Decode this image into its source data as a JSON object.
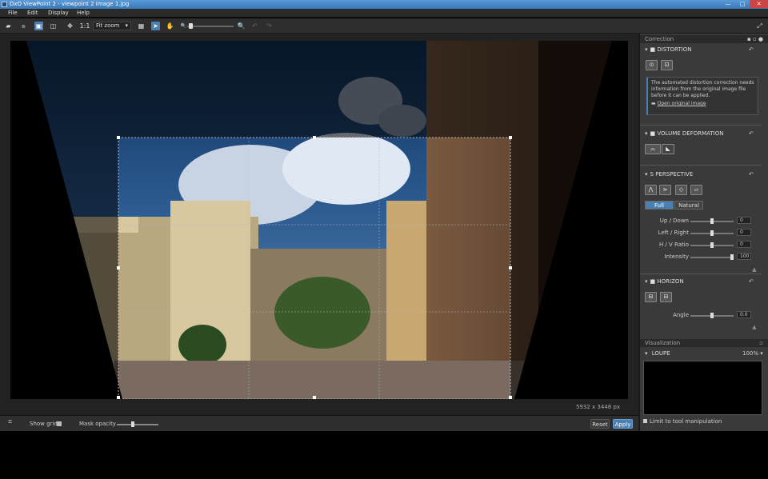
{
  "window": {
    "title": "DxO ViewPoint 2 - viewpoint 2 image 1.jpg",
    "min": "—",
    "max": "□",
    "close": "✕"
  },
  "menu": [
    "File",
    "Edit",
    "Display",
    "Help"
  ],
  "toolbar": {
    "zoom": "Fit zoom",
    "one_to_one": "1:1"
  },
  "viewer": {
    "dimensions": "5932 x 3448 px"
  },
  "bottom": {
    "show_grid": "Show grid",
    "mask_opacity": "Mask opacity",
    "reset": "Reset",
    "apply": "Apply"
  },
  "panel": {
    "header": "Correction",
    "distortion": {
      "title": "DISTORTION",
      "info": "The automated distortion correction needs information from the original image file before it can be applied.",
      "open_link": "Open original image"
    },
    "volume": {
      "title": "VOLUME DEFORMATION"
    },
    "perspective": {
      "title": "PERSPECTIVE",
      "full": "Full",
      "natural": "Natural",
      "sliders": [
        {
          "label": "Up / Down",
          "value": "0"
        },
        {
          "label": "Left / Right",
          "value": "0"
        },
        {
          "label": "H / V Ratio",
          "value": "0"
        },
        {
          "label": "Intensity",
          "value": "100"
        }
      ]
    },
    "horizon": {
      "title": "HORIZON",
      "angle_label": "Angle",
      "angle_value": "0.0"
    },
    "visualization": "Visualization",
    "loupe": {
      "title": "LOUPE",
      "zoom": "100%",
      "limit": "Limit to tool manipulation"
    }
  }
}
